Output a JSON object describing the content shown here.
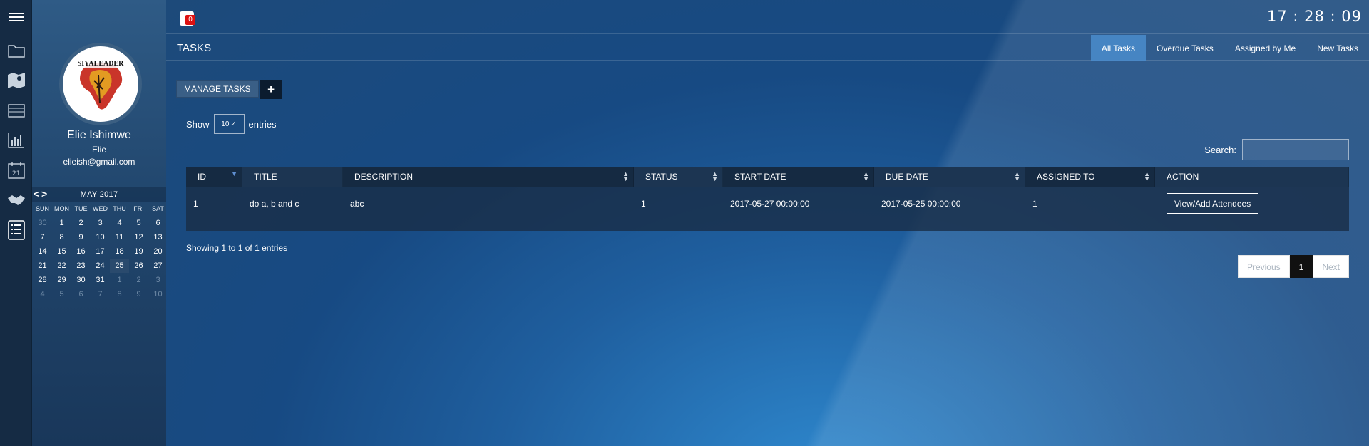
{
  "clock": "17 : 28 : 09",
  "notifications": {
    "count": "0"
  },
  "page": {
    "title": "TASKS"
  },
  "tabs": [
    {
      "label": "All Tasks",
      "active": true
    },
    {
      "label": "Overdue Tasks"
    },
    {
      "label": "Assigned by Me"
    },
    {
      "label": "New Tasks"
    }
  ],
  "rail": {
    "icons": [
      "menu-icon",
      "folder-icon",
      "map-icon",
      "tray-icon",
      "bar-chart-icon",
      "calendar-icon",
      "handshake-icon",
      "task-list-icon"
    ]
  },
  "profile": {
    "logo_text": "SIYALEADER",
    "name": "Elie Ishimwe",
    "username": "Elie",
    "email": "elieish@gmail.com"
  },
  "calendar": {
    "prev": "<",
    "next": ">",
    "month": "MAY 2017",
    "dow": [
      "SUN",
      "MON",
      "TUE",
      "WED",
      "THU",
      "FRI",
      "SAT"
    ],
    "days": [
      [
        "30",
        "1",
        "2",
        "3",
        "4",
        "5",
        "6"
      ],
      [
        "7",
        "8",
        "9",
        "10",
        "11",
        "12",
        "13"
      ],
      [
        "14",
        "15",
        "16",
        "17",
        "18",
        "19",
        "20"
      ],
      [
        "21",
        "22",
        "23",
        "24",
        "25",
        "26",
        "27"
      ],
      [
        "28",
        "29",
        "30",
        "31",
        "1",
        "2",
        "3"
      ],
      [
        "4",
        "5",
        "6",
        "7",
        "8",
        "9",
        "10"
      ]
    ]
  },
  "manage": {
    "label": "MANAGE TASKS",
    "plus": "+"
  },
  "entries": {
    "show": "Show",
    "value": "10",
    "suffix": "entries"
  },
  "search": {
    "label": "Search:"
  },
  "table": {
    "headers": [
      "ID",
      "TITLE",
      "DESCRIPTION",
      "STATUS",
      "START DATE",
      "DUE DATE",
      "ASSIGNED TO",
      "ACTION"
    ],
    "rows": [
      {
        "id": "1",
        "title": "do a, b and c",
        "description": "abc",
        "status": "1",
        "start": "2017-05-27 00:00:00",
        "due": "2017-05-25 00:00:00",
        "assigned": "1",
        "action": "View/Add Attendees"
      }
    ]
  },
  "info": "Showing 1 to 1 of 1 entries",
  "pagination": {
    "previous": "Previous",
    "current": "1",
    "next": "Next"
  }
}
